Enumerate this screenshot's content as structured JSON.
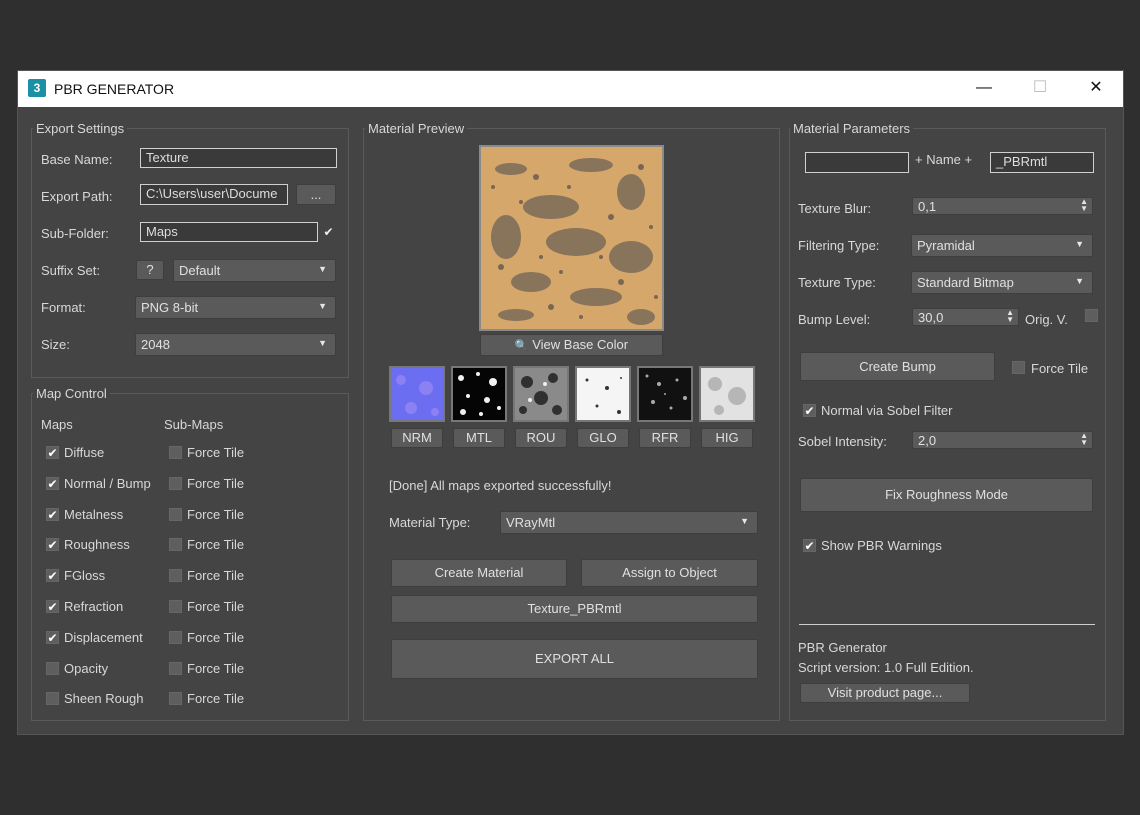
{
  "window": {
    "title": "PBR GENERATOR",
    "app_icon_glyph": "3",
    "minimize_glyph": "—",
    "maximize_glyph": "☐",
    "close_glyph": "✕"
  },
  "export_settings": {
    "group_label": "Export Settings",
    "base_name_label": "Base Name:",
    "base_name_value": "Texture",
    "export_path_label": "Export Path:",
    "export_path_value": "C:\\Users\\user\\Docume",
    "browse_label": "...",
    "subfolder_label": "Sub-Folder:",
    "subfolder_value": "Maps",
    "subfolder_checked": "✔",
    "suffix_label": "Suffix Set:",
    "suffix_help": "?",
    "suffix_value": "Default",
    "format_label": "Format:",
    "format_value": "PNG 8-bit",
    "size_label": "Size:",
    "size_value": "2048"
  },
  "map_control": {
    "group_label": "Map Control",
    "maps_header": "Maps",
    "submaps_header": "Sub-Maps",
    "force_tile_label": "Force Tile",
    "rows": [
      {
        "label": "Diffuse",
        "check": "✔",
        "ft": "Force Tile"
      },
      {
        "label": "Normal / Bump",
        "check": "✔",
        "ft": "Force Tile"
      },
      {
        "label": "Metalness",
        "check": "✔",
        "ft": "Force Tile"
      },
      {
        "label": "Roughness",
        "check": "✔",
        "ft": "Force Tile"
      },
      {
        "label": "FGloss",
        "check": "✔",
        "ft": "Force Tile"
      },
      {
        "label": "Refraction",
        "check": "✔",
        "ft": "Force Tile"
      },
      {
        "label": "Displacement",
        "check": "✔",
        "ft": "Force Tile"
      },
      {
        "label": "Opacity",
        "check": "",
        "ft": "Force Tile"
      },
      {
        "label": "Sheen Rough",
        "check": "",
        "ft": "Force Tile"
      }
    ]
  },
  "material_preview": {
    "group_label": "Material Preview",
    "view_base_color": "View Base Color",
    "search_icon": "🔍",
    "maps": [
      "NRM",
      "MTL",
      "ROU",
      "GLO",
      "RFR",
      "HIG"
    ],
    "status": "[Done] All maps exported successfully!",
    "material_type_label": "Material Type:",
    "material_type_value": "VRayMtl",
    "create_material": "Create Material",
    "assign_to_object": "Assign to Object",
    "material_name": "Texture_PBRmtl",
    "export_all": "EXPORT ALL"
  },
  "material_parameters": {
    "group_label": "Material Parameters",
    "prefix_value": "",
    "name_join": "+ Name +",
    "suffix_value": "_PBRmtl",
    "texture_blur_label": "Texture Blur:",
    "texture_blur_value": "0,1",
    "filtering_type_label": "Filtering Type:",
    "filtering_type_value": "Pyramidal",
    "texture_type_label": "Texture Type:",
    "texture_type_value": "Standard Bitmap",
    "bump_level_label": "Bump Level:",
    "bump_level_value": "30,0",
    "orig_v_label": "Orig. V.",
    "create_bump": "Create Bump",
    "force_tile_label": "Force Tile",
    "normal_sobel_label": "Normal via Sobel Filter",
    "normal_sobel_check": "✔",
    "sobel_intensity_label": "Sobel Intensity:",
    "sobel_intensity_value": "2,0",
    "fix_roughness": "Fix Roughness Mode",
    "show_warnings_label": "Show PBR Warnings",
    "show_warnings_check": "✔",
    "footer_title": "PBR Generator",
    "footer_version": "Script version: 1.0 Full Edition.",
    "visit_page": "Visit product page..."
  },
  "colors": {
    "window_bg": "#444444",
    "page_bg": "#2f2f2f",
    "titlebar_bg": "#ffffff",
    "preview_texture": "#d6a76a"
  }
}
